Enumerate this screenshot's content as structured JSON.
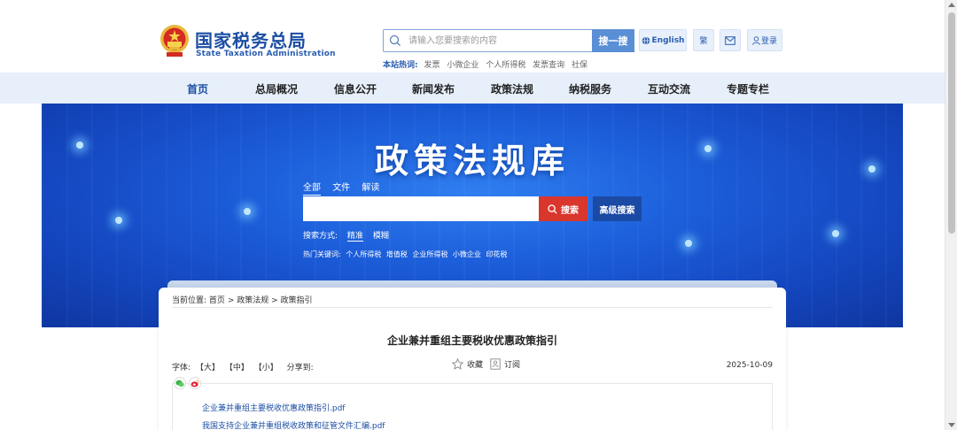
{
  "header": {
    "logo_cn": "国家税务总局",
    "logo_en": "State Taxation Administration",
    "search_placeholder": "请输入您要搜索的内容",
    "search_button": "搜一搜",
    "hot_label": "本站热词:",
    "hot_words": [
      "发票",
      "小微企业",
      "个人所得税",
      "发票查询",
      "社保"
    ],
    "english_label": "English",
    "traditional_label": "繁",
    "login_label": "登录"
  },
  "nav": {
    "items": [
      "首页",
      "总局概况",
      "信息公开",
      "新闻发布",
      "政策法规",
      "纳税服务",
      "互动交流",
      "专题专栏"
    ]
  },
  "banner": {
    "title": "政策法规库",
    "tabs": [
      "全部",
      "文件",
      "解读"
    ],
    "search_button": "搜索",
    "advanced_button": "高级搜索",
    "mode_label": "搜索方式:",
    "modes": [
      "精准",
      "模糊"
    ],
    "hot_label": "热门关键词:",
    "hot_keywords": [
      "个人所得税",
      "增值税",
      "企业所得税",
      "小微企业",
      "印花税"
    ]
  },
  "article": {
    "breadcrumb_label": "当前位置:",
    "breadcrumb": [
      "首页",
      "政策法规",
      "政策指引"
    ],
    "breadcrumb_sep": ">",
    "title": "企业兼并重组主要税收优惠政策指引",
    "font_label": "字体:",
    "font_sizes": [
      "【大】",
      "【中】",
      "【小】"
    ],
    "share_label": "分享到:",
    "favorite_label": "收藏",
    "subscribe_label": "订阅",
    "date": "2025-10-09",
    "attachments": [
      "企业兼并重组主要税收优惠政策指引.pdf",
      "我国支持企业兼并重组税收政策和征管文件汇编.pdf"
    ]
  },
  "colors": {
    "brand_blue": "#1c4ea3",
    "nav_bg": "#e6effa",
    "search_red": "#d9362e",
    "adv_blue": "#1b4aa5"
  }
}
